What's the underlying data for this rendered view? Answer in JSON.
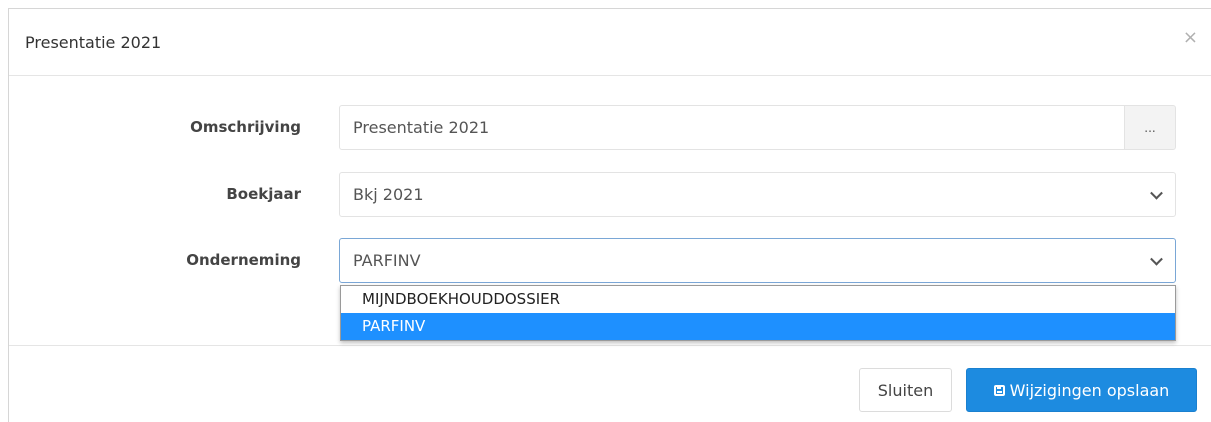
{
  "modal": {
    "title": "Presentatie 2021",
    "close_glyph": "×"
  },
  "form": {
    "omschrijving": {
      "label": "Omschrijving",
      "value": "Presentatie 2021",
      "addon_label": "..."
    },
    "boekjaar": {
      "label": "Boekjaar",
      "selected": "Bkj 2021"
    },
    "onderneming": {
      "label": "Onderneming",
      "selected": "PARFINV",
      "options": [
        "MIJNDBOEKHOUDDOSSIER",
        "PARFINV"
      ]
    }
  },
  "footer": {
    "close_label": "Sluiten",
    "save_label": "Wijzigingen opslaan"
  },
  "colors": {
    "primary": "#1d8be0",
    "option_highlight": "#1e90ff"
  },
  "icons": {
    "close": "close-icon",
    "select_arrow": "chevron-down-icon",
    "save": "floppy-disk-icon"
  }
}
